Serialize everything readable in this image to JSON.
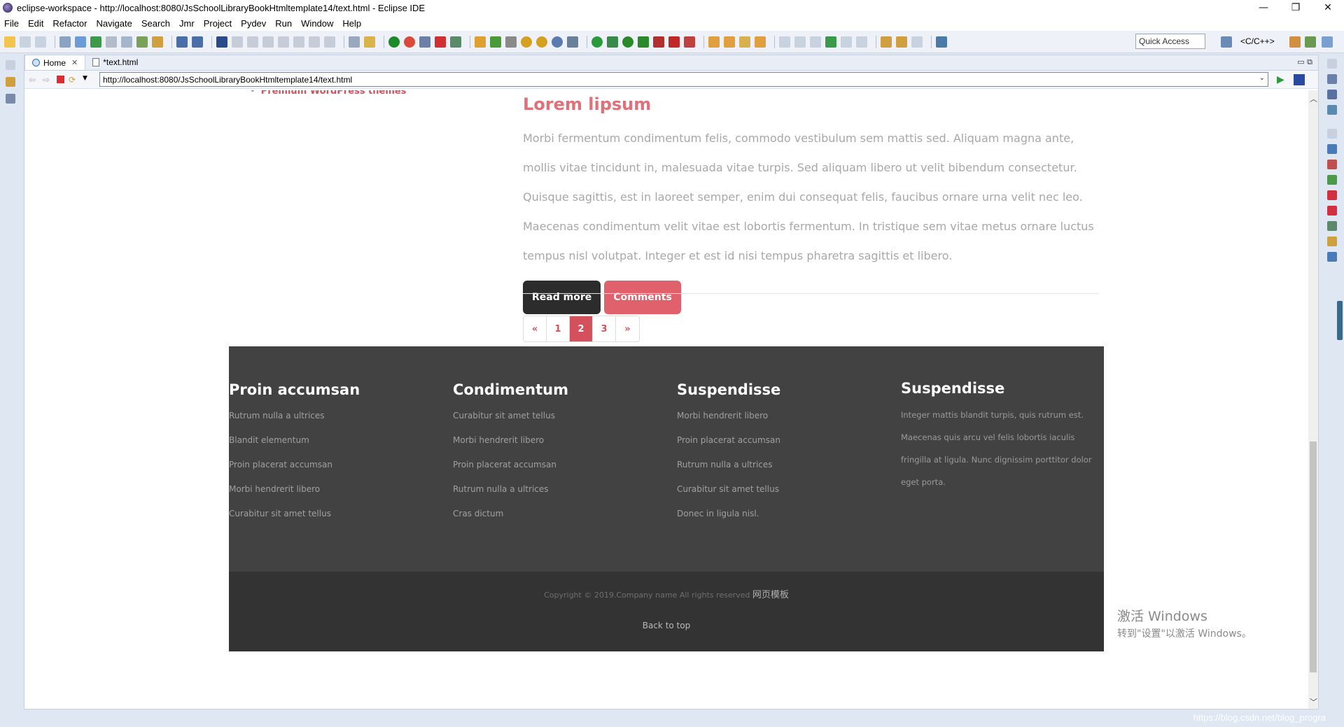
{
  "window": {
    "title": "eclipse-workspace - http://localhost:8080/JsSchoolLibraryBookHtmltemplate14/text.html - Eclipse IDE",
    "minimize": "—",
    "restore": "❐",
    "close": "✕"
  },
  "menu": [
    "File",
    "Edit",
    "Refactor",
    "Navigate",
    "Search",
    "Jmr",
    "Project",
    "Pydev",
    "Run",
    "Window",
    "Help"
  ],
  "toolbar": {
    "quick_access": "Quick Access",
    "perspective": "<C/C++>"
  },
  "tabs": [
    {
      "label": "Home",
      "close": "✕"
    },
    {
      "label": "*text.html"
    }
  ],
  "browser": {
    "url": "http://localhost:8080/JsSchoolLibraryBookHtmltemplate14/text.html"
  },
  "page": {
    "sidebar_link": "Premium WordPress themes",
    "post": {
      "title": "Lorem lipsum",
      "body": "Morbi fermentum condimentum felis, commodo vestibulum sem mattis sed. Aliquam magna ante, mollis vitae tincidunt in, malesuada vitae turpis. Sed aliquam libero ut velit bibendum consectetur. Quisque sagittis, est in laoreet semper, enim dui consequat felis, faucibus ornare urna velit nec leo. Maecenas condimentum velit vitae est lobortis fermentum. In tristique sem vitae metus ornare luctus tempus nisl volutpat. Integer et est id nisi tempus pharetra sagittis et libero.",
      "read_more": "Read more",
      "comments": "Comments"
    },
    "pagination": [
      "«",
      "1",
      "2",
      "3",
      "»"
    ],
    "pagination_active": "2",
    "footer": {
      "col1": {
        "title": "Proin accumsan",
        "items": [
          "Rutrum nulla a ultrices",
          "Blandit elementum",
          "Proin placerat accumsan",
          "Morbi hendrerit libero",
          "Curabitur sit amet tellus"
        ]
      },
      "col2": {
        "title": "Condimentum",
        "items": [
          "Curabitur sit amet tellus",
          "Morbi hendrerit libero",
          "Proin placerat accumsan",
          "Rutrum nulla a ultrices",
          "Cras dictum"
        ]
      },
      "col3": {
        "title": "Suspendisse",
        "items": [
          "Morbi hendrerit libero",
          "Proin placerat accumsan",
          "Rutrum nulla a ultrices",
          "Curabitur sit amet tellus",
          "Donec in ligula nisl."
        ]
      },
      "col4": {
        "title": "Suspendisse",
        "text": "Integer mattis blandit turpis, quis rutrum est. Maecenas quis arcu vel felis lobortis iaculis fringilla at ligula. Nunc dignissim porttitor dolor eget porta."
      }
    },
    "copyright": "Copyright © 2019.Company name All rights reserved",
    "copyright_cn": "网页模板",
    "back_to_top": "Back to top"
  },
  "watermark": {
    "line1": "激活 Windows",
    "line2": "转到\"设置\"以激活 Windows。"
  },
  "status": {
    "blog": "https://blog.csdn.net/blog_progra"
  },
  "colors": {
    "accent": "#d5505d",
    "footer_bg": "#424242",
    "bottom_bg": "#333333"
  }
}
